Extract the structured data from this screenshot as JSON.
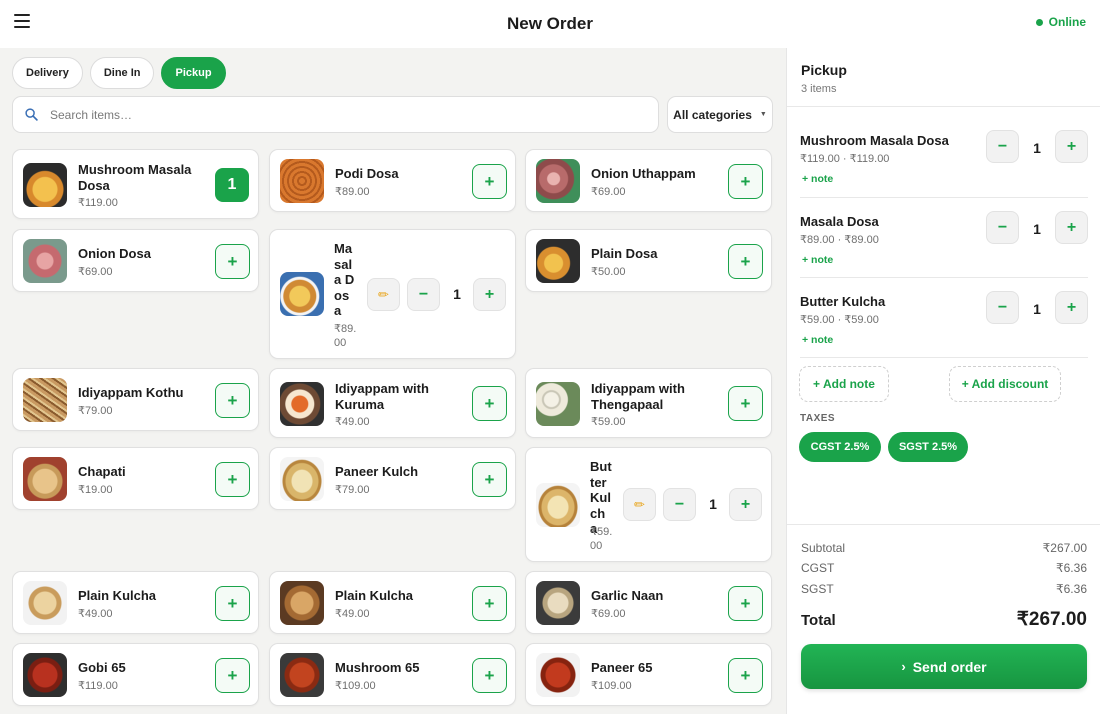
{
  "header": {
    "title": "New Order",
    "status": "Online",
    "status_color": "#1aa34a"
  },
  "order_modes": [
    {
      "label": "Delivery",
      "active": false
    },
    {
      "label": "Dine In",
      "active": false
    },
    {
      "label": "Pickup",
      "active": true
    }
  ],
  "search": {
    "placeholder": "Search items…",
    "value": ""
  },
  "category_filter": {
    "label": "All categories"
  },
  "menu_items": [
    {
      "name": "Mushroom Masala Dosa",
      "price": "₹119.00",
      "quantity": "1"
    },
    {
      "name": "Podi Dosa",
      "price": "₹89.00"
    },
    {
      "name": "Onion Uthappam",
      "price": "₹69.00"
    },
    {
      "name": "Onion Dosa",
      "price": "₹69.00"
    },
    {
      "name": "Masala Dosa",
      "price": "₹89.00",
      "quantity": "1"
    },
    {
      "name": "Plain Dosa",
      "price": "₹50.00"
    },
    {
      "name": "Idiyappam Kothu",
      "price": "₹79.00"
    },
    {
      "name": "Idiyappam with Kuruma",
      "price": "₹49.00"
    },
    {
      "name": "Idiyappam with Thengapaal",
      "price": "₹59.00"
    },
    {
      "name": "Chapati",
      "price": "₹19.00"
    },
    {
      "name": "Paneer Kulch",
      "price": "₹79.00"
    },
    {
      "name": "Butter Kulcha",
      "price": "₹59.00",
      "quantity": "1"
    },
    {
      "name": "Plain Kulcha",
      "price": "₹49.00"
    },
    {
      "name": "Plain Kulcha",
      "price": "₹49.00"
    },
    {
      "name": "Garlic Naan",
      "price": "₹69.00"
    },
    {
      "name": "Gobi 65",
      "price": "₹119.00"
    },
    {
      "name": "Mushroom 65",
      "price": "₹109.00"
    },
    {
      "name": "Paneer 65",
      "price": "₹109.00"
    }
  ],
  "order": {
    "title": "Pickup",
    "item_count": "3 items",
    "items": [
      {
        "name": "Mushroom Masala Dosa",
        "price_line": "₹119.00 · ₹119.00",
        "quantity": "1",
        "note_label": "+ note"
      },
      {
        "name": "Masala Dosa",
        "price_line": "₹89.00 · ₹89.00",
        "quantity": "1",
        "note_label": "+ note"
      },
      {
        "name": "Butter Kulcha",
        "price_line": "₹59.00 · ₹59.00",
        "quantity": "1",
        "note_label": "+ note"
      }
    ],
    "add_note_label": "+ Add note",
    "add_discount_label": "+ Add discount",
    "taxes_label": "TAXES",
    "taxes": [
      {
        "label": "CGST 2.5%"
      },
      {
        "label": "SGST 2.5%"
      }
    ],
    "summary": {
      "subtotal_label": "Subtotal",
      "subtotal": "₹267.00",
      "cgst_label": "CGST",
      "cgst": "₹6.36",
      "sgst_label": "SGST",
      "sgst": "₹6.36",
      "total_label": "Total",
      "total": "₹267.00"
    },
    "send_label": "Send order"
  },
  "icons": {
    "menu": "menu-icon",
    "search": "search-icon",
    "edit": "pencil-icon",
    "send": "chevron-right-icon"
  },
  "colors": {
    "accent": "#1aa34a",
    "background": "#f3f3f1"
  }
}
